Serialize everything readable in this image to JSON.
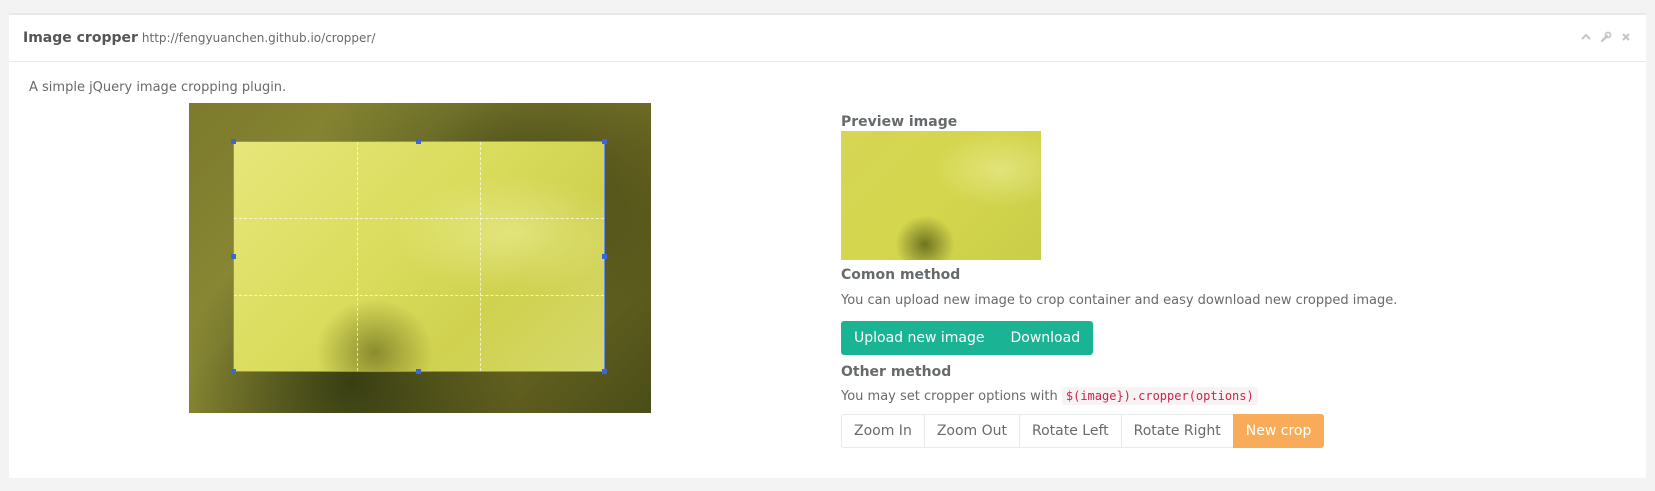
{
  "panel": {
    "title": "Image cropper",
    "subtitle": "http://fengyuanchen.github.io/cropper/",
    "tools": {
      "collapse_icon": "chevron-up-icon",
      "config_icon": "wrench-icon",
      "close_icon": "close-icon"
    }
  },
  "intro": "A simple jQuery image cropping plugin.",
  "preview": {
    "heading": "Preview image"
  },
  "common": {
    "heading": "Comon method",
    "description": "You can upload new image to crop container and easy download new cropped image.",
    "buttons": [
      "Upload new image",
      "Download"
    ]
  },
  "other": {
    "heading": "Other method",
    "description_prefix": "You may set cropper options with",
    "code": "$(image}).cropper(options)",
    "buttons": [
      "Zoom In",
      "Zoom Out",
      "Rotate Left",
      "Rotate Right"
    ],
    "new_crop": "New crop"
  },
  "colors": {
    "primary": "#1ab394",
    "warning": "#f8ac59",
    "crop_outline": "#6d8fe0"
  }
}
